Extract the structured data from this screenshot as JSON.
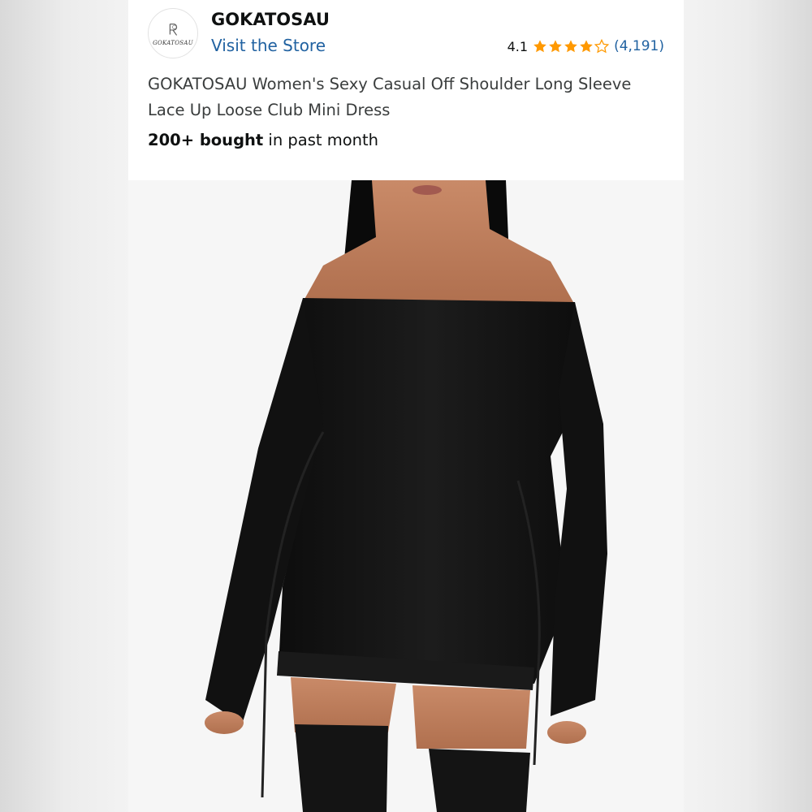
{
  "store": {
    "logo_text": "GOKATOSAU",
    "name": "GOKATOSAU",
    "visit_label": "Visit the Store"
  },
  "rating": {
    "value": "4.1",
    "stars": 4.1,
    "count": "(4,191)",
    "star_color": "#ff9900"
  },
  "product": {
    "title": "GOKATOSAU Women's Sexy Casual Off Shoulder Long Sleeve Lace Up Loose Club Mini Dress",
    "bought_strong": "200+ bought",
    "bought_rest": " in past month",
    "image_icon": "product-photo"
  },
  "colors": {
    "link": "#2162a1",
    "text": "#0f1111"
  }
}
